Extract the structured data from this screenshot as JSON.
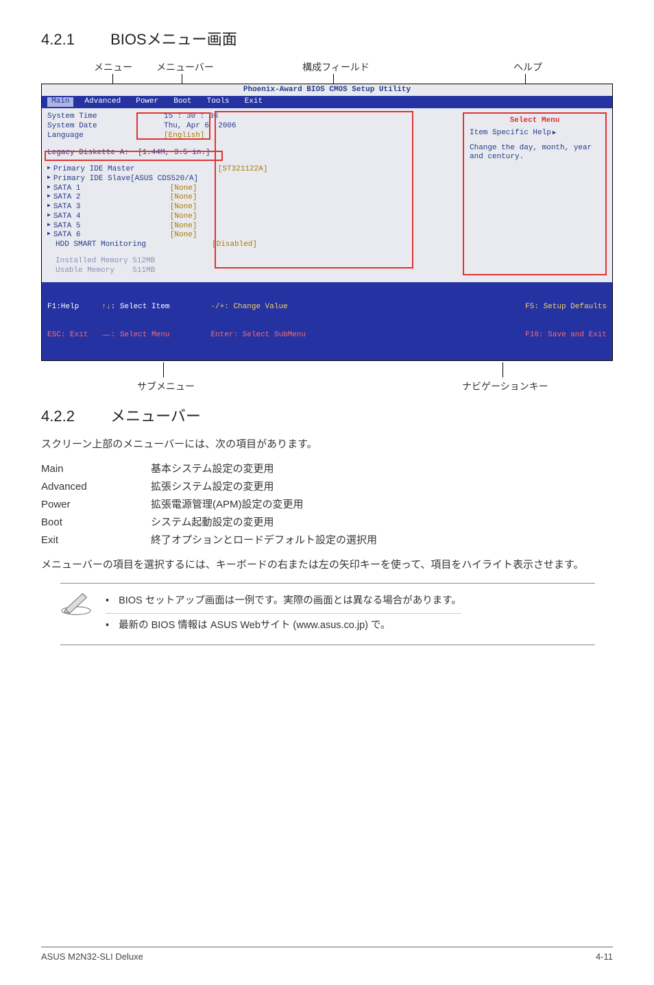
{
  "sections": {
    "s421_num": "4.2.1",
    "s421_title": "BIOSメニュー画面",
    "s422_num": "4.2.2",
    "s422_title": "メニューバー"
  },
  "annotations": {
    "menu": "メニュー",
    "menubar": "メニューバー",
    "config_field": "構成フィールド",
    "help": "ヘルプ",
    "submenu": "サブメニュー",
    "nav_keys": "ナビゲーションキー"
  },
  "bios": {
    "title": "Phoenix-Award BIOS CMOS Setup Utility",
    "tabs": [
      "Main",
      "Advanced",
      "Power",
      "Boot",
      "Tools",
      "Exit"
    ],
    "rows": {
      "system_time_k": "System Time",
      "system_time_v": "15 : 30 : 36",
      "system_date_k": "System Date",
      "system_date_v": "Thu, Apr 6  2006",
      "language_k": "Language",
      "language_v": "[English]",
      "legacy": "Legacy Diskette A:  [1.44M, 3.5 in.]",
      "pim_k": "Primary IDE Master",
      "pim_v": "[ST321122A]",
      "pis": "Primary IDE Slave[ASUS CDS520/A]",
      "sata1_k": "SATA 1",
      "sata1_v": "[None]",
      "sata2_k": "SATA 2",
      "sata2_v": "[None]",
      "sata3_k": "SATA 3",
      "sata3_v": "[None]",
      "sata4_k": "SATA 4",
      "sata4_v": "[None]",
      "sata5_k": "SATA 5",
      "sata5_v": "[None]",
      "sata6_k": "SATA 6",
      "sata6_v": "[None]",
      "hdd_k": "HDD SMART Monitoring",
      "hdd_v": "[Disabled]",
      "installed": "Installed Memory 512MB",
      "usable": "Usable Memory    511MB"
    },
    "help_pane": {
      "select_menu": "Select Menu",
      "item_specific": "Item Specific Help",
      "help_text": "Change the day, month, year and century."
    },
    "footer": {
      "f1": "F1:Help",
      "esc": "ESC: Exit",
      "sel_item": ": Select Item",
      "sel_menu": ": Select Menu",
      "change": "-/+: Change Value",
      "enter": "Enter: Select SubMenu",
      "f5": "F5: Setup Defaults",
      "f10": "F10: Save and Exit"
    }
  },
  "body": {
    "intro": "スクリーン上部のメニューバーには、次の項目があります。",
    "defs": [
      {
        "term": "Main",
        "desc": "基本システム設定の変更用"
      },
      {
        "term": "Advanced",
        "desc": "拡張システム設定の変更用"
      },
      {
        "term": "Power",
        "desc": "拡張電源管理(APM)設定の変更用"
      },
      {
        "term": "Boot",
        "desc": "システム起動設定の変更用"
      },
      {
        "term": "Exit",
        "desc": "終了オプションとロードデフォルト設定の選択用"
      }
    ],
    "after": "メニューバーの項目を選択するには、キーボードの右または左の矢印キーを使って、項目をハイライト表示させます。"
  },
  "notes": [
    "BIOS セットアップ画面は一例です。実際の画面とは異なる場合があります。",
    "最新の BIOS 情報は ASUS Webサイト (www.asus.co.jp) で。"
  ],
  "footer": {
    "left": "ASUS M2N32-SLI Deluxe",
    "right": "4-11"
  }
}
